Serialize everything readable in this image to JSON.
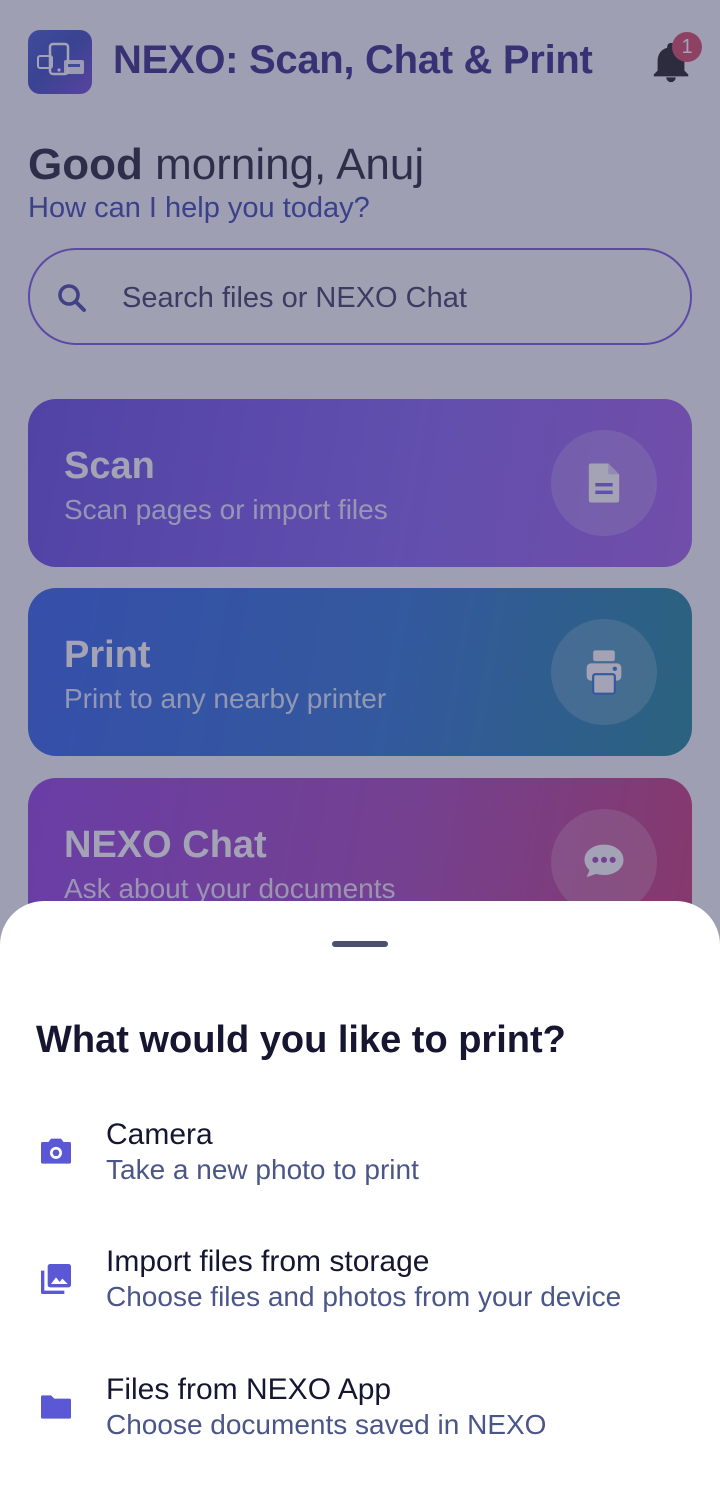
{
  "app": {
    "title": "NEXO: Scan, Chat & Print",
    "notification_count": "1"
  },
  "greeting": {
    "hello": "Good",
    "rest": "morning, Anuj",
    "subtitle": "How can I help you today?"
  },
  "search": {
    "placeholder": "Search files or NEXO Chat"
  },
  "cards": [
    {
      "title": "Scan",
      "subtitle": "Scan pages or import files",
      "icon": "document-icon"
    },
    {
      "title": "Print",
      "subtitle": "Print to any nearby printer",
      "icon": "printer-icon"
    },
    {
      "title": "NEXO Chat",
      "subtitle": "Ask about your documents",
      "icon": "chat-bubble-icon"
    }
  ],
  "sheet": {
    "title": "What would you like to print?",
    "options": [
      {
        "title": "Camera",
        "subtitle": "Take a new photo to print",
        "icon": "camera-icon"
      },
      {
        "title": "Import files from storage",
        "subtitle": "Choose files and photos from your device",
        "icon": "image-gallery-icon"
      },
      {
        "title": "Files from NEXO App",
        "subtitle": "Choose documents saved in NEXO",
        "icon": "folder-icon"
      }
    ]
  },
  "colors": {
    "brand": "#241c7c",
    "accent": "#6b4fe0",
    "scan_card": "#7a56f0",
    "print_card": "#1f6ad0",
    "chat_card": "#a03ab6",
    "badge": "#d23a5a",
    "scrim": "#48486c"
  }
}
